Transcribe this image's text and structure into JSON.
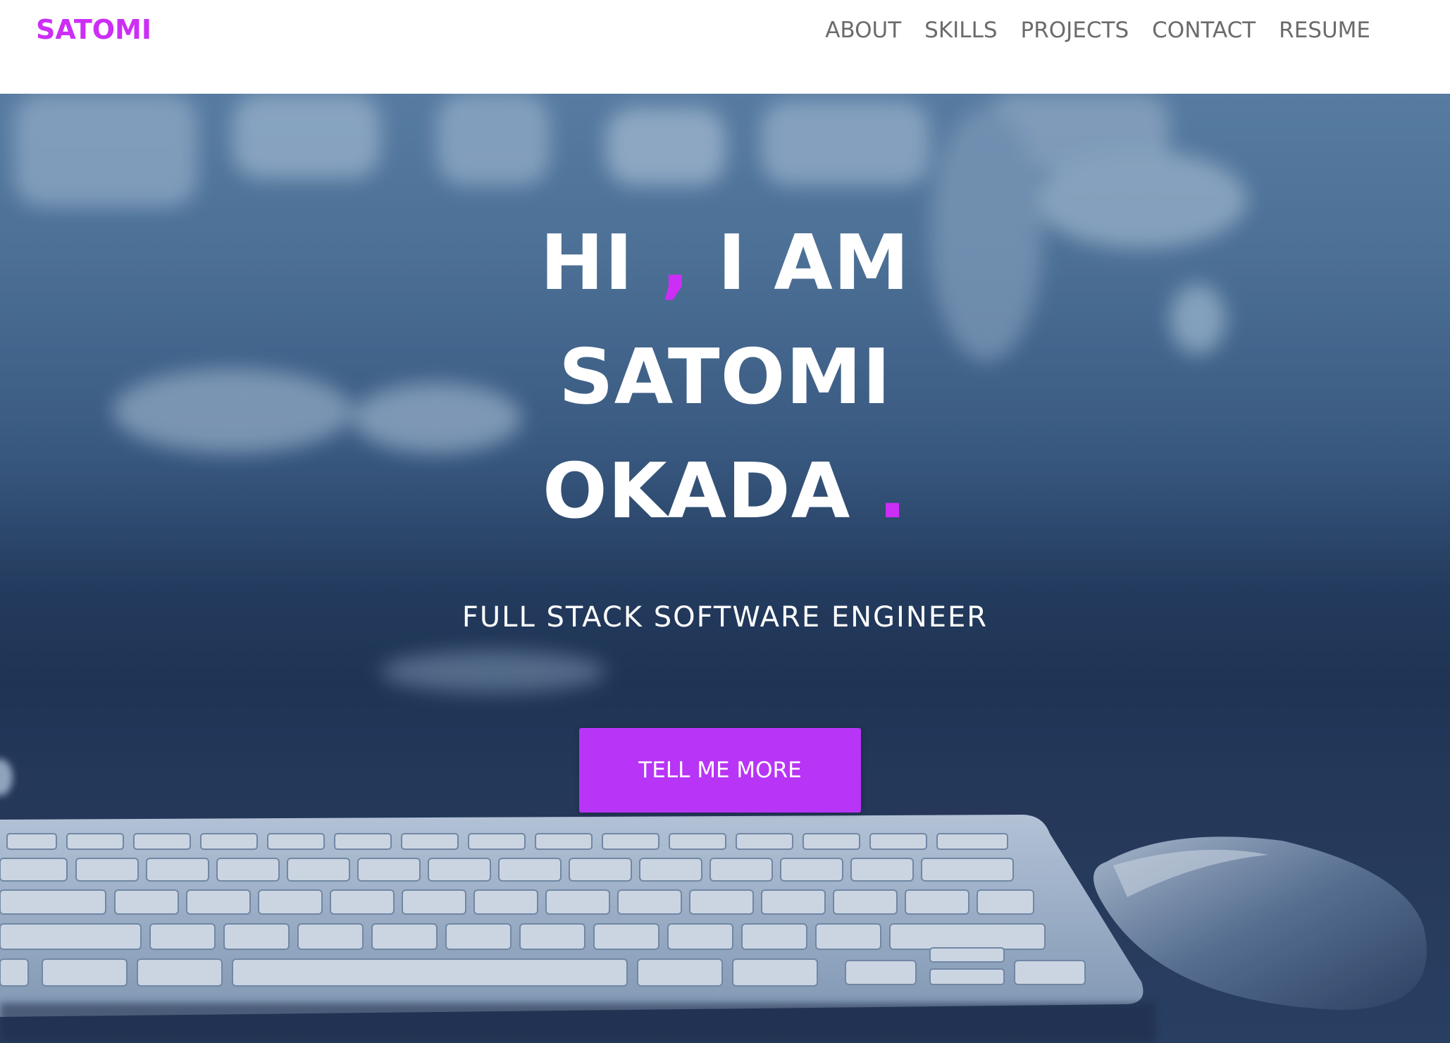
{
  "brand": {
    "name": "SATOMI",
    "color": "#cc2ef5"
  },
  "nav": {
    "items": [
      {
        "label": "ABOUT"
      },
      {
        "label": "SKILLS"
      },
      {
        "label": "PROJECTS"
      },
      {
        "label": "CONTACT"
      },
      {
        "label": "RESUME"
      }
    ]
  },
  "hero": {
    "line1_a": "HI",
    "line1_comma": ",",
    "line1_b": "I AM",
    "line2": "SATOMI",
    "line3": "OKADA",
    "line3_dot": ".",
    "subtitle": "FULL STACK SOFTWARE ENGINEER",
    "cta_label": "TELL ME MORE",
    "accent_color": "#cc2ef5",
    "button_color": "#b834f7"
  }
}
